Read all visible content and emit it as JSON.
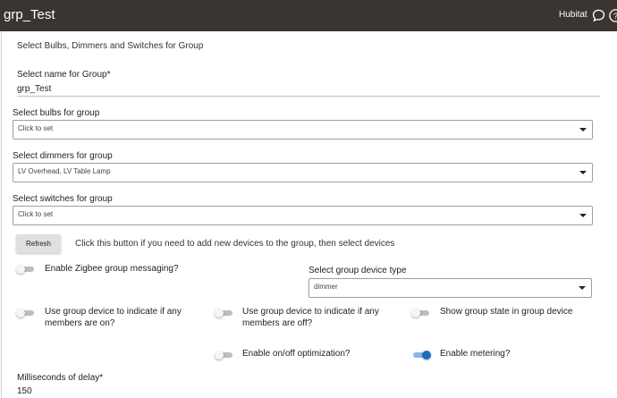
{
  "header": {
    "title": "grp_Test",
    "brand": "Hubitat",
    "bg_color": "#3b3531"
  },
  "form": {
    "intro": "Select Bulbs, Dimmers and Switches for Group",
    "group_name": {
      "label": "Select name for Group*",
      "value": "grp_Test"
    },
    "bulbs": {
      "label": "Select bulbs for group",
      "value": "Click to set"
    },
    "dimmers": {
      "label": "Select dimmers for group",
      "value": "LV Overhead, LV Table Lamp"
    },
    "switches": {
      "label": "Select switches for group",
      "value": "Click to set"
    },
    "refresh": {
      "button_label": "Refresh",
      "hint": "Click this button if you need to add new devices to the group, then select devices"
    },
    "zigbee": {
      "label": "Enable Zigbee group messaging?",
      "on": false
    },
    "device_type": {
      "label": "Select group device type",
      "value": "dimmer"
    },
    "indicate_on": {
      "label_line1": "Use group device to indicate if any",
      "label_line2": "members are on?",
      "on": false
    },
    "indicate_off": {
      "label_line1": "Use group device to indicate if any",
      "label_line2": "members are off?",
      "on": false
    },
    "show_state": {
      "label": "Show group state in group device",
      "on": false
    },
    "onoff_opt": {
      "label": "Enable on/off optimization?",
      "on": false
    },
    "metering": {
      "label": "Enable metering?",
      "on": true
    },
    "delay": {
      "label": "Milliseconds of delay*",
      "value": "150"
    }
  },
  "colors": {
    "accent": "#1e6bc2"
  }
}
